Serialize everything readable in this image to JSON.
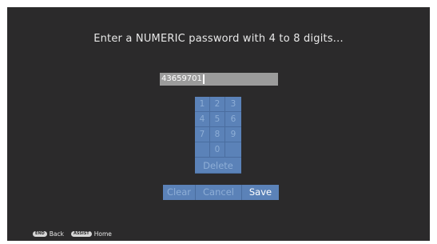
{
  "prompt": "Enter a NUMERIC password with 4 to 8 digits...",
  "password_field": {
    "value": "43659701"
  },
  "keypad": {
    "rows": [
      [
        "1",
        "2",
        "3"
      ],
      [
        "4",
        "5",
        "6"
      ],
      [
        "7",
        "8",
        "9"
      ]
    ],
    "zero": "0",
    "delete": "Delete"
  },
  "actions": {
    "clear": "Clear",
    "cancel": "Cancel",
    "save": "Save",
    "selected": "save"
  },
  "footer": {
    "back_key": "END",
    "back_label": "Back",
    "home_key": "ASSIST",
    "home_label": "Home"
  },
  "colors": {
    "background": "#2b2a2b",
    "keypad": "#5b82b8",
    "keypad_text": "#8eaed6",
    "field": "#9b9b9b"
  }
}
